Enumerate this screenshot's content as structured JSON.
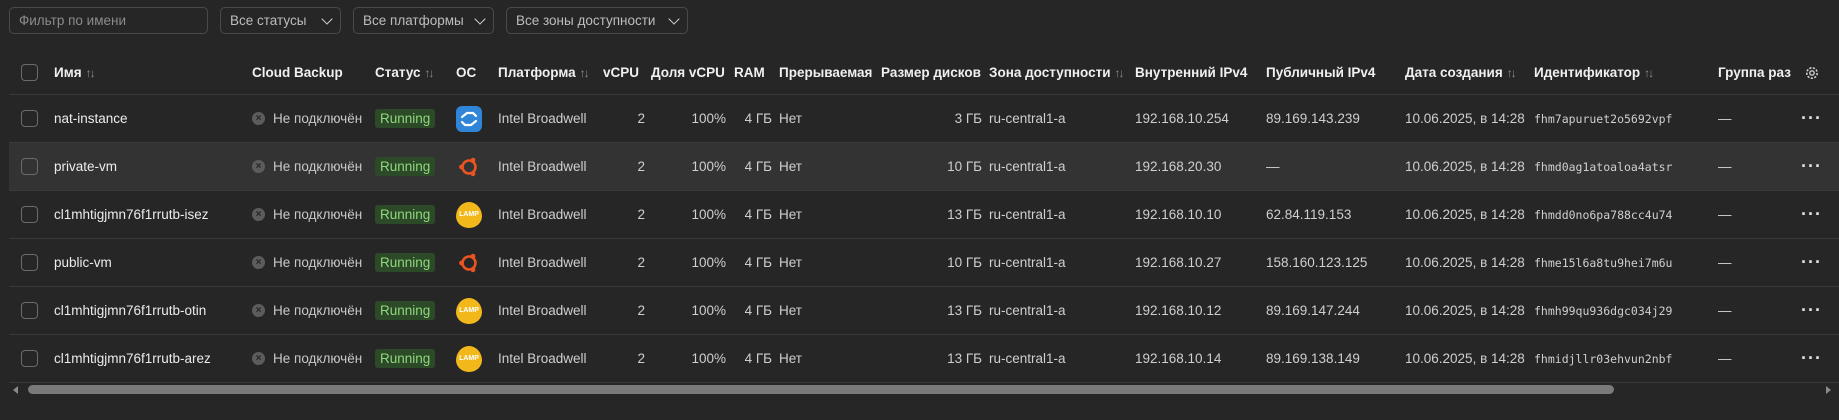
{
  "filters": {
    "name_placeholder": "Фильтр по имени",
    "status": "Все статусы",
    "platform": "Все платформы",
    "zone": "Все зоны доступности"
  },
  "columns": {
    "name": "Имя",
    "backup": "Cloud Backup",
    "status": "Статус",
    "os": "ОС",
    "platform": "Платформа",
    "vcpu": "vCPU",
    "vcpu_share": "Доля vCPU",
    "ram": "RAM",
    "preemptible": "Прерываемая",
    "disk": "Размер дисков",
    "zone": "Зона доступности",
    "ip_internal": "Внутренний IPv4",
    "ip_public": "Публичный IPv4",
    "created": "Дата создания",
    "id": "Идентификатор",
    "group": "Группа раз",
    "sort_glyph": "↑↓"
  },
  "rows": [
    {
      "name": "nat-instance",
      "backup": "Не подключён",
      "status": "Running",
      "os_icon": "alpine-icon",
      "platform": "Intel Broadwell",
      "vcpu": "2",
      "share": "100%",
      "ram": "4 ГБ",
      "preemptible": "Нет",
      "disk": "3 ГБ",
      "zone": "ru-central1-a",
      "ip_int": "192.168.10.254",
      "ip_pub": "89.169.143.239",
      "created": "10.06.2025, в 14:28",
      "id": "fhm7apuruet2o5692vpf",
      "group": "—"
    },
    {
      "name": "private-vm",
      "backup": "Не подключён",
      "status": "Running",
      "os_icon": "ubuntu-icon",
      "platform": "Intel Broadwell",
      "vcpu": "2",
      "share": "100%",
      "ram": "4 ГБ",
      "preemptible": "Нет",
      "disk": "10 ГБ",
      "zone": "ru-central1-a",
      "ip_int": "192.168.20.30",
      "ip_pub": "—",
      "created": "10.06.2025, в 14:28",
      "id": "fhmd0ag1atoaloa4atsr",
      "group": "—"
    },
    {
      "name": "cl1mhtigjmn76f1rrutb-isez",
      "backup": "Не подключён",
      "status": "Running",
      "os_icon": "lamp-icon",
      "platform": "Intel Broadwell",
      "vcpu": "2",
      "share": "100%",
      "ram": "4 ГБ",
      "preemptible": "Нет",
      "disk": "13 ГБ",
      "zone": "ru-central1-a",
      "ip_int": "192.168.10.10",
      "ip_pub": "62.84.119.153",
      "created": "10.06.2025, в 14:28",
      "id": "fhmdd0no6pa788cc4u74",
      "group": "—"
    },
    {
      "name": "public-vm",
      "backup": "Не подключён",
      "status": "Running",
      "os_icon": "ubuntu-icon",
      "platform": "Intel Broadwell",
      "vcpu": "2",
      "share": "100%",
      "ram": "4 ГБ",
      "preemptible": "Нет",
      "disk": "10 ГБ",
      "zone": "ru-central1-a",
      "ip_int": "192.168.10.27",
      "ip_pub": "158.160.123.125",
      "created": "10.06.2025, в 14:28",
      "id": "fhme15l6a8tu9hei7m6u",
      "group": "—"
    },
    {
      "name": "cl1mhtigjmn76f1rrutb-otin",
      "backup": "Не подключён",
      "status": "Running",
      "os_icon": "lamp-icon",
      "platform": "Intel Broadwell",
      "vcpu": "2",
      "share": "100%",
      "ram": "4 ГБ",
      "preemptible": "Нет",
      "disk": "13 ГБ",
      "zone": "ru-central1-a",
      "ip_int": "192.168.10.12",
      "ip_pub": "89.169.147.244",
      "created": "10.06.2025, в 14:28",
      "id": "fhmh99qu936dgc034j29",
      "group": "—"
    },
    {
      "name": "cl1mhtigjmn76f1rrutb-arez",
      "backup": "Не подключён",
      "status": "Running",
      "os_icon": "lamp-icon",
      "platform": "Intel Broadwell",
      "vcpu": "2",
      "share": "100%",
      "ram": "4 ГБ",
      "preemptible": "Нет",
      "disk": "13 ГБ",
      "zone": "ru-central1-a",
      "ip_int": "192.168.10.14",
      "ip_pub": "89.169.138.149",
      "created": "10.06.2025, в 14:28",
      "id": "fhmidjllr03ehvun2nbf",
      "group": "—"
    }
  ],
  "lamp_label": "LAMP",
  "more_glyph": "···",
  "colors": {
    "background": "#262626",
    "running_badge_bg": "#2c4a28",
    "running_badge_text": "#8fd67e",
    "alpine_blue": "#2f86d8",
    "ubuntu_orange": "#e95420",
    "lamp_yellow": "#f2b81b"
  }
}
